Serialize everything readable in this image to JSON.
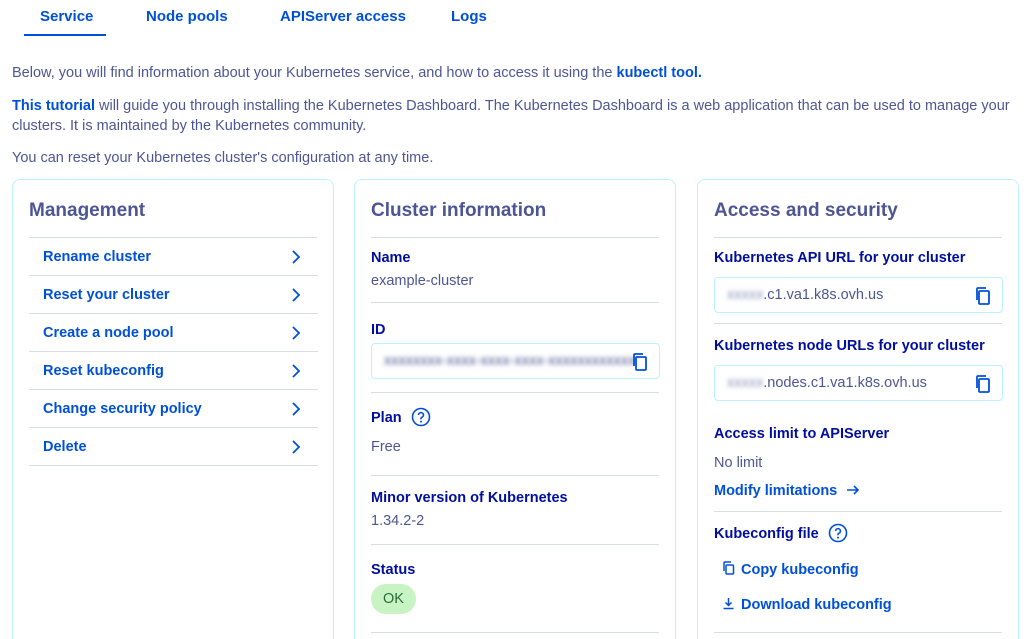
{
  "tabs": [
    {
      "label": "Service",
      "active": true
    },
    {
      "label": "Node pools",
      "active": false
    },
    {
      "label": "APIServer access",
      "active": false
    },
    {
      "label": "Logs",
      "active": false
    }
  ],
  "intro": {
    "line1_prefix": "Below, you will find information about your Kubernetes service, and how to access it using the ",
    "line1_link": "kubectl tool.",
    "line2_link": "This tutorial",
    "line2_rest": " will guide you through installing the Kubernetes Dashboard. The Kubernetes Dashboard is a web application that can be used to manage your clusters. It is maintained by the Kubernetes community.",
    "line3": "You can reset your Kubernetes cluster's configuration at any time."
  },
  "management": {
    "title": "Management",
    "items": [
      {
        "label": "Rename cluster"
      },
      {
        "label": "Reset your cluster"
      },
      {
        "label": "Create a node pool"
      },
      {
        "label": "Reset kubeconfig"
      },
      {
        "label": "Change security policy"
      },
      {
        "label": "Delete"
      }
    ]
  },
  "cluster_info": {
    "title": "Cluster information",
    "name_label": "Name",
    "name_value": "example-cluster",
    "id_label": "ID",
    "id_value_masked": "xxxxxxxx-xxxx-xxxx-xxxx-xxxxxxxxxxxx",
    "plan_label": "Plan",
    "plan_value": "Free",
    "version_label": "Minor version of Kubernetes",
    "version_value": "1.34.2-2",
    "status_label": "Status",
    "status_value": "OK"
  },
  "access": {
    "title": "Access and security",
    "api_url_label": "Kubernetes API URL for your cluster",
    "api_url_masked": "xxxxx",
    "api_url_suffix": ".c1.va1.k8s.ovh.us",
    "node_url_label": "Kubernetes node URLs for your cluster",
    "node_url_masked": "xxxxx",
    "node_url_suffix": ".nodes.c1.va1.k8s.ovh.us",
    "limit_label": "Access limit to APIServer",
    "limit_value": "No limit",
    "modify_link": "Modify limitations",
    "kubeconfig_label": "Kubeconfig file",
    "copy_kubeconfig": "Copy kubeconfig",
    "download_kubeconfig": "Download kubeconfig"
  },
  "colors": {
    "primary": "#0050d7",
    "text": "#4d5693",
    "card_border": "#bef1ff",
    "status_bg": "#c7f4c2"
  }
}
